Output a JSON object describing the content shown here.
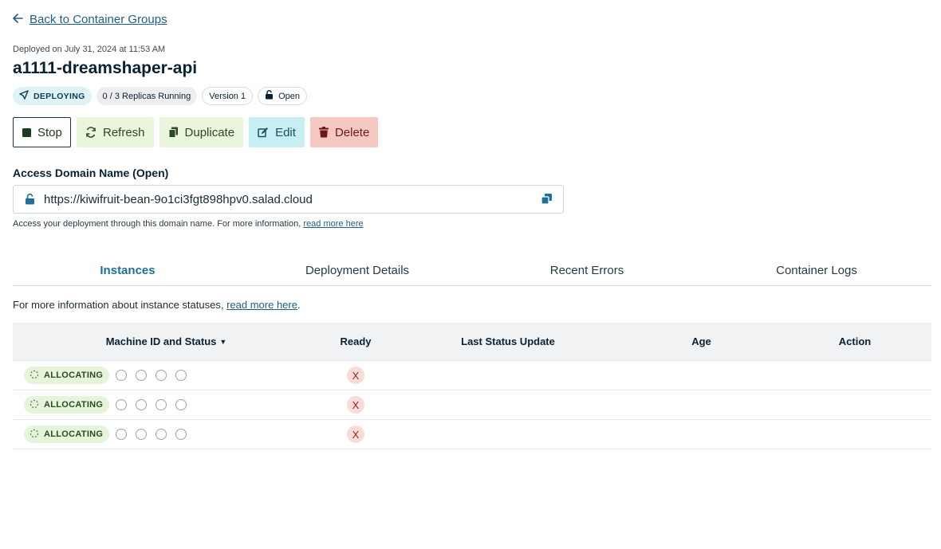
{
  "nav": {
    "back_label": "Back to Container Groups"
  },
  "header": {
    "deployed_text": "Deployed on July 31, 2024 at 11:53 AM",
    "title": "a1111-dreamshaper-api"
  },
  "badges": {
    "status": "DEPLOYING",
    "replicas": "0 / 3 Replicas Running",
    "version": "Version 1",
    "access": "Open"
  },
  "actions": {
    "stop": "Stop",
    "refresh": "Refresh",
    "duplicate": "Duplicate",
    "edit": "Edit",
    "delete": "Delete"
  },
  "domain": {
    "label": "Access Domain Name (Open)",
    "url": "https://kiwifruit-bean-9o1ci3fgt898hpv0.salad.cloud",
    "help_text": "Access your deployment through this domain name. For more information,",
    "help_link": "read more here"
  },
  "tabs": [
    {
      "label": "Instances"
    },
    {
      "label": "Deployment Details"
    },
    {
      "label": "Recent Errors"
    },
    {
      "label": "Container Logs"
    }
  ],
  "instances": {
    "info_text": "For more information about instance statuses,",
    "info_link": "read more here",
    "info_suffix": ".",
    "columns": {
      "machine": "Machine ID and Status",
      "ready": "Ready",
      "last_update": "Last Status Update",
      "age": "Age",
      "action": "Action"
    },
    "rows": [
      {
        "status": "ALLOCATING",
        "ready": "X"
      },
      {
        "status": "ALLOCATING",
        "ready": "X"
      },
      {
        "status": "ALLOCATING",
        "ready": "X"
      }
    ]
  },
  "colors": {
    "accent": "#1f6f9a",
    "link": "#1f5f86",
    "deploying_bg": "#dff2f6",
    "allocating_bg": "#e6f4dc",
    "delete_bg": "#f6c8c2",
    "edit_bg": "#c6eef3",
    "refresh_bg": "#e9f5dc"
  }
}
